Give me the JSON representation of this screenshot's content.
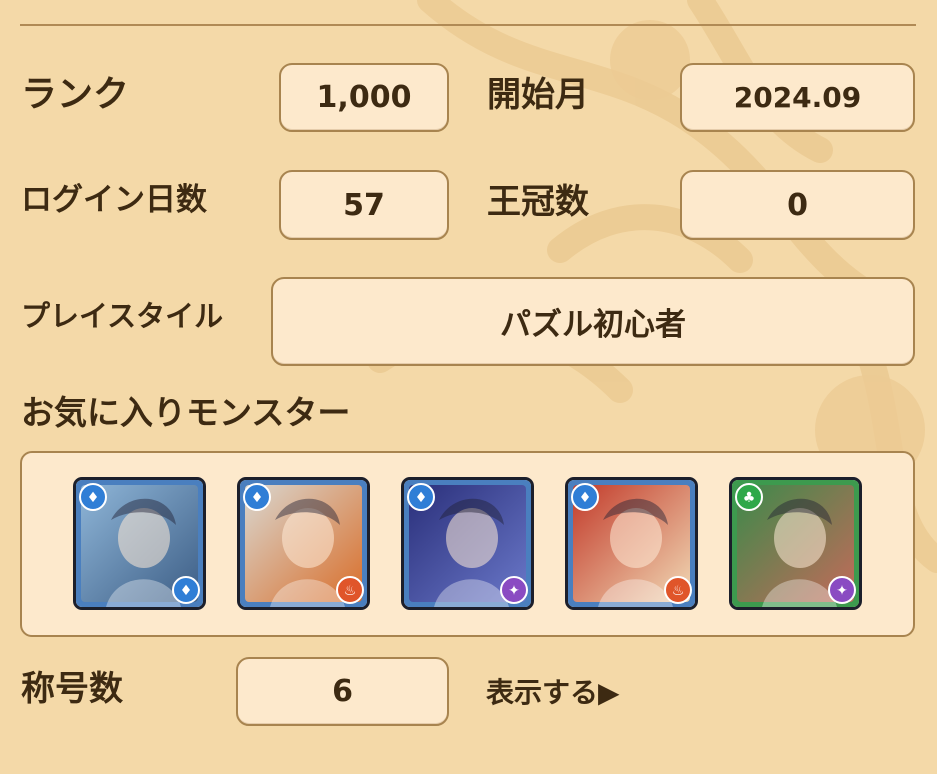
{
  "rows": {
    "rank": {
      "label": "ランク",
      "value": "1,000"
    },
    "start_month": {
      "label": "開始月",
      "value": "2024.09"
    },
    "login_days": {
      "label": "ログイン日数",
      "value": "57"
    },
    "crowns": {
      "label": "王冠数",
      "value": "0"
    },
    "play_style": {
      "label": "プレイスタイル",
      "value": "パズル初心者"
    },
    "titles": {
      "label": "称号数",
      "value": "6",
      "show_link": "表示する▶"
    }
  },
  "favorites": {
    "heading": "お気に入りモンスター",
    "monsters": [
      {
        "main_attr": "water",
        "sub_attr": "water",
        "palette": [
          "#8fb6d8",
          "#3d5e86"
        ]
      },
      {
        "main_attr": "water",
        "sub_attr": "fire",
        "palette": [
          "#d9d7d0",
          "#d96e2a"
        ]
      },
      {
        "main_attr": "water",
        "sub_attr": "dark",
        "palette": [
          "#2a2f7a",
          "#6a78c9"
        ]
      },
      {
        "main_attr": "water",
        "sub_attr": "fire",
        "palette": [
          "#c23a2a",
          "#f1d9b5"
        ]
      },
      {
        "main_attr": "wood",
        "sub_attr": "dark",
        "palette": [
          "#3c8a4a",
          "#c46a5a"
        ]
      }
    ]
  },
  "colors": {
    "background": "#f4d9a8",
    "box_fill": "#fde9cc",
    "box_border": "#a8844f",
    "text": "#3d2a12",
    "water": "#2f7ed6",
    "fire": "#e0552a",
    "wood": "#2fa84a",
    "dark": "#8a4bc2"
  }
}
